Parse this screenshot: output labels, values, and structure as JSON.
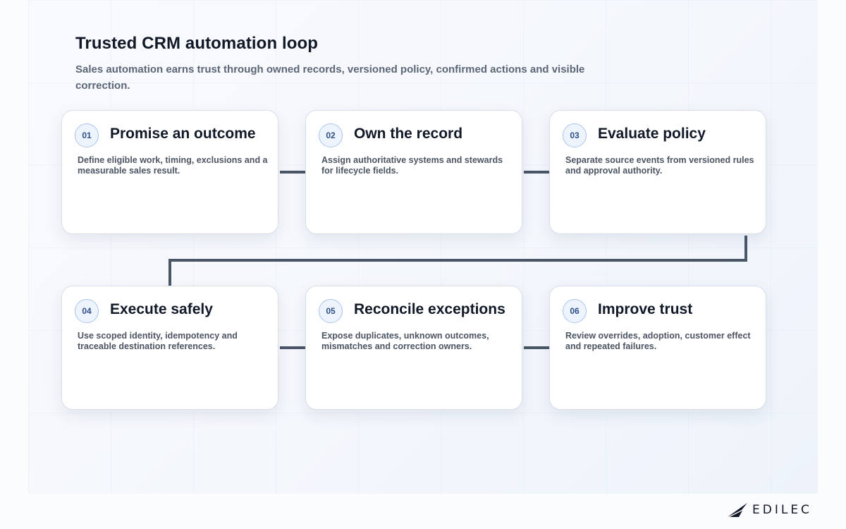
{
  "header": {
    "title": "Trusted CRM automation loop",
    "subtitle": "Sales automation earns trust through owned records, versioned policy, confirmed actions and visible correction."
  },
  "steps": [
    {
      "number": "01",
      "title": "Promise an outcome",
      "description": "Define eligible work, timing, exclusions and a measurable sales result."
    },
    {
      "number": "02",
      "title": "Own the record",
      "description": "Assign authoritative systems and stewards for lifecycle fields."
    },
    {
      "number": "03",
      "title": "Evaluate policy",
      "description": "Separate source events from versioned rules and approval authority."
    },
    {
      "number": "04",
      "title": "Execute safely",
      "description": "Use scoped identity, idempotency and traceable destination references."
    },
    {
      "number": "05",
      "title": "Reconcile exceptions",
      "description": "Expose duplicates, unknown outcomes, mismatches and correction owners."
    },
    {
      "number": "06",
      "title": "Improve trust",
      "description": "Review overrides, adoption, customer effect and repeated failures."
    }
  ],
  "brand": {
    "name": "EDILEC",
    "logo_icon": "edilec-wing-logo-icon"
  },
  "colors": {
    "connector": "#4a5568",
    "badge_border": "#a9c4ea",
    "badge_text": "#2f4f86",
    "title": "#111827"
  }
}
